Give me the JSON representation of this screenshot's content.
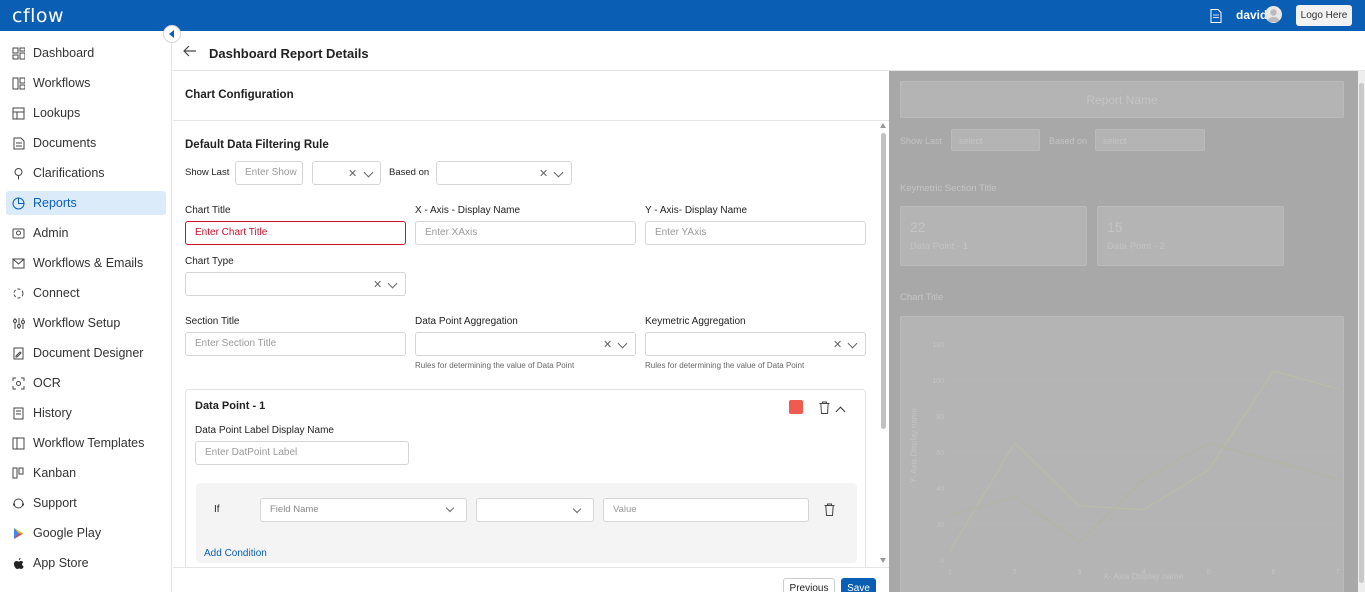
{
  "topbar": {
    "logo": "cflow",
    "username": "david",
    "logo_button": "Logo Here"
  },
  "sidebar": {
    "items": [
      {
        "label": "Dashboard",
        "icon": "dashboard-icon"
      },
      {
        "label": "Workflows",
        "icon": "workflows-icon"
      },
      {
        "label": "Lookups",
        "icon": "lookups-icon"
      },
      {
        "label": "Documents",
        "icon": "documents-icon"
      },
      {
        "label": "Clarifications",
        "icon": "clarifications-icon"
      },
      {
        "label": "Reports",
        "icon": "reports-icon",
        "active": true
      },
      {
        "label": "Admin",
        "icon": "admin-icon"
      },
      {
        "label": "Workflows & Emails",
        "icon": "mail-icon"
      },
      {
        "label": "Connect",
        "icon": "connect-icon"
      },
      {
        "label": "Workflow Setup",
        "icon": "setup-icon"
      },
      {
        "label": "Document Designer",
        "icon": "designer-icon"
      },
      {
        "label": "OCR",
        "icon": "ocr-icon"
      },
      {
        "label": "History",
        "icon": "history-icon"
      },
      {
        "label": "Workflow Templates",
        "icon": "templates-icon"
      },
      {
        "label": "Kanban",
        "icon": "kanban-icon"
      },
      {
        "label": "Support",
        "icon": "support-icon"
      },
      {
        "label": "Google Play",
        "icon": "google-play-icon"
      },
      {
        "label": "App Store",
        "icon": "apple-icon"
      }
    ]
  },
  "header": {
    "title": "Dashboard Report Details"
  },
  "config": {
    "title": "Chart Configuration",
    "filter_title": "Default Data Filtering Rule",
    "show_last_label": "Show Last",
    "show_last_placeholder": "Enter Show",
    "based_on_label": "Based on",
    "chart_title_label": "Chart Title",
    "chart_title_placeholder": "Enter Chart Title",
    "x_axis_label": "X - Axis - Display Name",
    "x_axis_placeholder": "Enter XAxis",
    "y_axis_label": "Y - Axis- Display Name",
    "y_axis_placeholder": "Enter YAxis",
    "chart_type_label": "Chart Type",
    "section_title_label": "Section Title",
    "section_title_placeholder": "Enter Section Title",
    "data_point_agg_label": "Data Point Aggregation",
    "data_point_agg_hint": "Rules for determining the value of Data Point",
    "keymetric_agg_label": "Keymetric Aggregation",
    "keymetric_agg_hint": "Rules for determining the value of Data Point",
    "data_point": {
      "title": "Data Point - 1",
      "color": "#f05a4f",
      "label_display_name": "Data Point Label Display Name",
      "label_placeholder": "Enter DatPoint Label",
      "if_label": "If",
      "field_name_placeholder": "Field Name",
      "value_placeholder": "Value",
      "add_condition": "Add Condition"
    },
    "previous_button": "Previous",
    "save_button": "Save"
  },
  "preview": {
    "report_name": "Report Name",
    "show_last": "Show Last",
    "select1": "select",
    "based_on": "Based on",
    "select2": "select",
    "keymetric_section_title": "Keymetric Section Title",
    "keymetrics": [
      {
        "value": "22",
        "label": "Data Point - 1"
      },
      {
        "value": "15",
        "label": "Data Point - 2"
      }
    ],
    "chart_title": "Chart Title",
    "y_axis_title": "Y- Axis Display name",
    "x_axis_title": "X- Axis Display name"
  },
  "chart_data": {
    "type": "line",
    "title": "Chart Title",
    "xlabel": "X- Axis Display name",
    "ylabel": "Y- Axis Display name",
    "x": [
      1,
      2,
      3,
      4,
      5,
      6,
      7
    ],
    "y_ticks": [
      0,
      20,
      40,
      60,
      80,
      100,
      120
    ],
    "ylim": [
      0,
      120
    ],
    "series": [
      {
        "values": [
          5,
          65,
          30,
          28,
          50,
          105,
          95
        ],
        "color": "#bdbda4"
      },
      {
        "values": [
          25,
          35,
          10,
          45,
          65,
          55,
          45
        ],
        "color": "#b0b69c"
      }
    ]
  }
}
